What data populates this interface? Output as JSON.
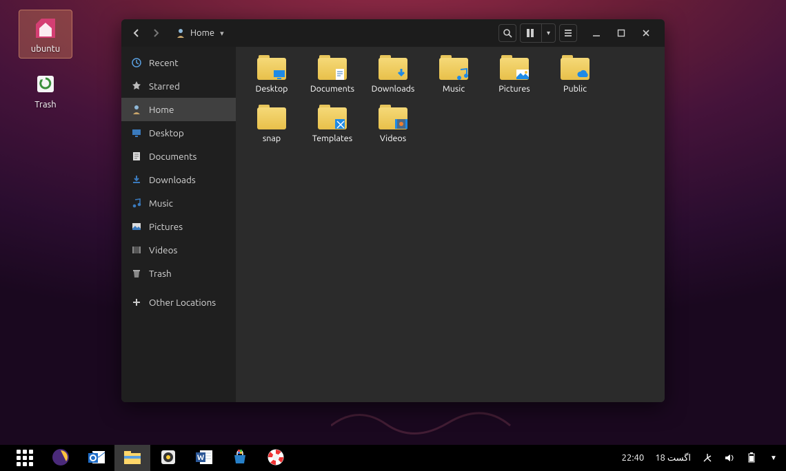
{
  "desktop": {
    "icons": [
      {
        "name": "ubuntu",
        "label": "ubuntu",
        "kind": "home",
        "selected": true
      },
      {
        "name": "trash",
        "label": "Trash",
        "kind": "trash",
        "selected": false
      }
    ]
  },
  "fileManager": {
    "breadcrumb": "Home",
    "sidebar": [
      {
        "key": "recent",
        "label": "Recent",
        "icon": "clock"
      },
      {
        "key": "starred",
        "label": "Starred",
        "icon": "star"
      },
      {
        "key": "home",
        "label": "Home",
        "icon": "home",
        "active": true
      },
      {
        "key": "desktop",
        "label": "Desktop",
        "icon": "desktop"
      },
      {
        "key": "documents",
        "label": "Documents",
        "icon": "doc"
      },
      {
        "key": "downloads",
        "label": "Downloads",
        "icon": "download"
      },
      {
        "key": "music",
        "label": "Music",
        "icon": "music"
      },
      {
        "key": "pictures",
        "label": "Pictures",
        "icon": "picture"
      },
      {
        "key": "videos",
        "label": "Videos",
        "icon": "video"
      },
      {
        "key": "trash",
        "label": "Trash",
        "icon": "trash"
      },
      {
        "key": "other",
        "label": "Other Locations",
        "icon": "plus",
        "gapBefore": true
      }
    ],
    "folders": [
      {
        "name": "Desktop",
        "overlay": "monitor"
      },
      {
        "name": "Documents",
        "overlay": "doc"
      },
      {
        "name": "Downloads",
        "overlay": "download"
      },
      {
        "name": "Music",
        "overlay": "music"
      },
      {
        "name": "Pictures",
        "overlay": "picture"
      },
      {
        "name": "Public",
        "overlay": "cloud"
      },
      {
        "name": "snap",
        "overlay": ""
      },
      {
        "name": "Templates",
        "overlay": "template"
      },
      {
        "name": "Videos",
        "overlay": "video"
      }
    ]
  },
  "taskbar": {
    "apps": [
      {
        "key": "apps",
        "icon": "grid"
      },
      {
        "key": "firefox",
        "icon": "firefox"
      },
      {
        "key": "outlook",
        "icon": "outlook"
      },
      {
        "key": "files",
        "icon": "explorer",
        "active": true
      },
      {
        "key": "rhythmbox",
        "icon": "speaker"
      },
      {
        "key": "word",
        "icon": "word"
      },
      {
        "key": "store",
        "icon": "store"
      },
      {
        "key": "help",
        "icon": "lifebuoy"
      }
    ],
    "clock": "22:40",
    "date": "اگست 18",
    "status": [
      "network",
      "volume",
      "battery",
      "chevron"
    ]
  }
}
